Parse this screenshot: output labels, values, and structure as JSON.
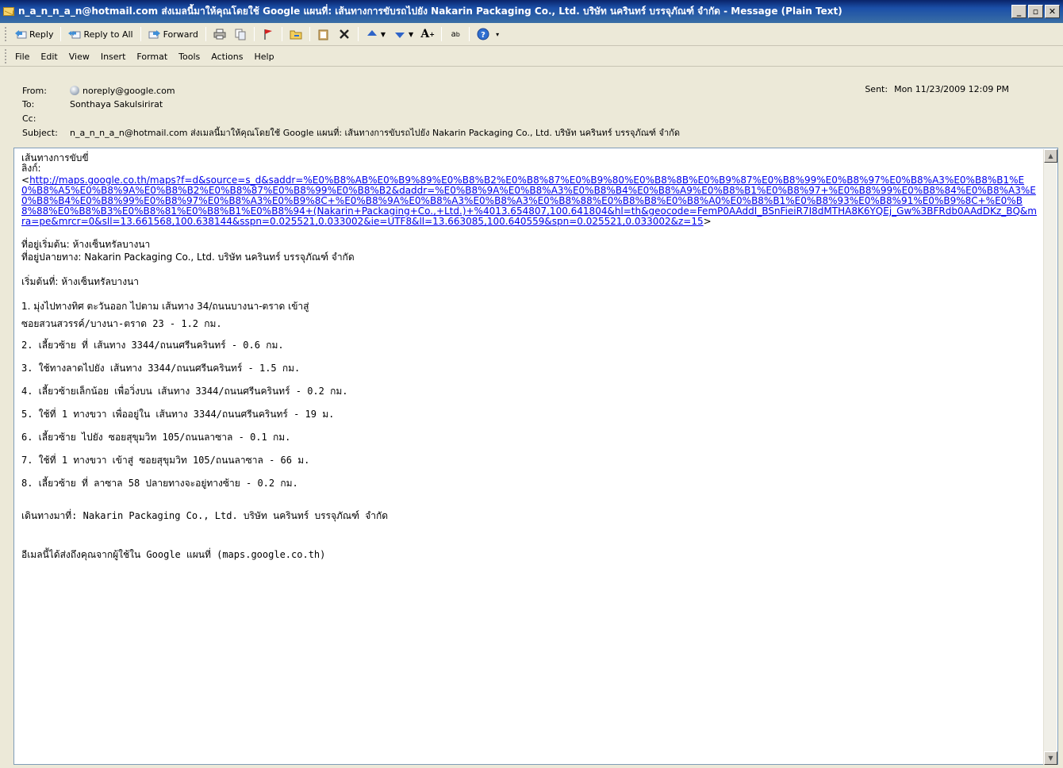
{
  "window": {
    "title": "n_a_n_n_a_n@hotmail.com ส่งเมลนี้มาให้คุณโดยใช้ Google แผนที่: เส้นทางการขับรถไปยัง Nakarin Packaging Co., Ltd. บริษัท นครินทร์ บรรจุภัณฑ์ จำกัด - Message (Plain Text)",
    "minimize": "_",
    "restore": "▫",
    "close": "✕"
  },
  "toolbar": {
    "reply": "Reply",
    "reply_all": "Reply to All",
    "forward": "Forward"
  },
  "menu": [
    "File",
    "Edit",
    "View",
    "Insert",
    "Format",
    "Tools",
    "Actions",
    "Help"
  ],
  "header": {
    "from_label": "From:",
    "from_value": "noreply@google.com",
    "to_label": "To:",
    "to_value": "Sonthaya Sakulsirirat",
    "cc_label": "Cc:",
    "cc_value": "",
    "subject_label": "Subject:",
    "subject_value": "n_a_n_n_a_n@hotmail.com ส่งเมลนี้มาให้คุณโดยใช้ Google แผนที่: เส้นทางการขับรถไปยัง Nakarin Packaging Co., Ltd. บริษัท นครินทร์ บรรจุภัณฑ์ จำกัด",
    "sent_label": "Sent:",
    "sent_value": "Mon 11/23/2009 12:09 PM"
  },
  "body": {
    "line1": "เส้นทางการขับขี่",
    "line2": "ลิงก์:",
    "link_open": "<",
    "link": "http://maps.google.co.th/maps?f=d&source=s_d&saddr=%E0%B8%AB%E0%B9%89%E0%B8%B2%E0%B8%87%E0%B9%80%E0%B8%8B%E0%B9%87%E0%B8%99%E0%B8%97%E0%B8%A3%E0%B8%B1%E0%B8%A5%E0%B8%9A%E0%B8%B2%E0%B8%87%E0%B8%99%E0%B8%B2&daddr=%E0%B8%9A%E0%B8%A3%E0%B8%B4%E0%B8%A9%E0%B8%B1%E0%B8%97+%E0%B8%99%E0%B8%84%E0%B8%A3%E0%B8%B4%E0%B8%99%E0%B8%97%E0%B8%A3%E0%B9%8C+%E0%B8%9A%E0%B8%A3%E0%B8%A3%E0%B8%88%E0%B8%B8%E0%B8%A0%E0%B8%B1%E0%B8%93%E0%B8%91%E0%B9%8C+%E0%B8%88%E0%B8%B3%E0%B8%81%E0%B8%B1%E0%B8%94+(Nakarin+Packaging+Co.,+Ltd.)+%4013.654807,100.641804&hl=th&geocode=FemP0AAddI_BSnFieiR7I8dMTHA8K6YQEj_Gw%3BFRdb0AAdDKz_BQ&mra=pe&mrcr=0&sll=13.661568,100.638144&sspn=0.025521,0.033002&ie=UTF8&ll=13.663085,100.640559&spn=0.025521,0.033002&z=15",
    "link_close": ">",
    "start_addr": "ที่อยู่เริ่มต้น: ห้างเซ็นทรัลบางนา",
    "end_addr": "ที่อยู่ปลายทาง: Nakarin Packaging Co., Ltd. บริษัท นครินทร์ บรรจุภัณฑ์ จำกัด",
    "start_point": "เริ่มต้นที่: ห้างเซ็นทรัลบางนา",
    "step1a": "1. มุ่งไปทางทิศ ตะวันออก ไปตาม เส้นทาง 34/ถนนบางนา-ตราด เข้าสู่",
    "step1b": "ซอยสวนสวรรค์/บางนา-ตราด 23 - 1.2  กม.",
    "steps": [
      "2. เลี้ยวซ้าย ที่ เส้นทาง 3344/ถนนศรีนครินทร์ - 0.6 กม.",
      "3. ใช้ทางลาดไปยัง เส้นทาง 3344/ถนนศรีนครินทร์ - 1.5 กม.",
      "4. เลี้ยวซ้ายเล็กน้อย เพื่อวิ่งบน เส้นทาง 3344/ถนนศรีนครินทร์ - 0.2 กม.",
      "5. ใช้ที่ 1 ทางขวา เพื่ออยู่ใน เส้นทาง 3344/ถนนศรีนครินทร์ - 19 ม.",
      "6. เลี้ยวซ้าย ไปยัง ซอยสุขุมวิท 105/ถนนลาซาล - 0.1 กม.",
      "7. ใช้ที่ 1 ทางขวา เข้าสู่ ซอยสุขุมวิท 105/ถนนลาซาล - 66 ม.",
      "8. เลี้ยวซ้าย ที่ ลาซาล 58  ปลายทางจะอยู่ทางซ้าย - 0.2 กม."
    ],
    "arrived": "เดินทางมาที่: Nakarin Packaging Co., Ltd. บริษัท นครินทร์ บรรจุภัณฑ์ จำกัด",
    "footer": "อีเมลนี้ได้ส่งถึงคุณจากผู้ใช้ใน Google แผนที่ (maps.google.co.th)"
  }
}
